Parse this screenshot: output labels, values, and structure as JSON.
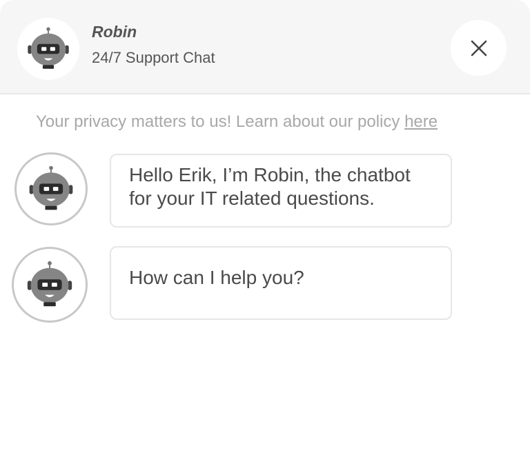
{
  "header": {
    "name": "Robin",
    "subtitle": "24/7 Support Chat",
    "avatar_icon": "robot-icon",
    "close_icon": "close-icon"
  },
  "privacy": {
    "text": "Your privacy matters to us! Learn about our policy ",
    "link_label": "here"
  },
  "messages": [
    {
      "sender": "Robin",
      "avatar_icon": "robot-icon",
      "text": "Hello Erik, I’m Robin, the chatbot for your IT related questions."
    },
    {
      "sender": "Robin",
      "avatar_icon": "robot-icon",
      "text": "How can I help you?"
    }
  ],
  "colors": {
    "header_bg": "#f6f6f6",
    "text": "#4a4a4a",
    "muted": "#a8a8a8",
    "robot_body": "#858585"
  }
}
